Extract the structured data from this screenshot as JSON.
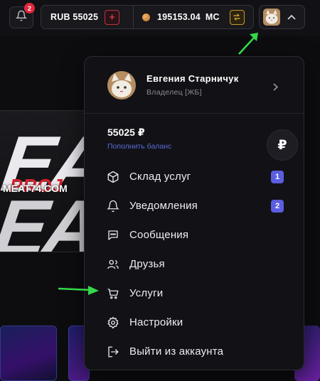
{
  "topbar": {
    "notification_count": "2",
    "rub_balance": "RUB 55025",
    "rub_add": "+",
    "mc_balance": "195153.04",
    "mc_unit": "MC",
    "exchange_icon": "exchange-icon"
  },
  "banner": {
    "url": "MEAT74.COM",
    "big_text": "EA",
    "proj_text": "PROJ"
  },
  "profile": {
    "name": "Евгения Старничук",
    "role": "Владелец [ЖБ]"
  },
  "balance": {
    "amount": "55025 ₽",
    "topup_link": "Пополнить баланс",
    "currency_symbol": "₽"
  },
  "menu": {
    "items": [
      {
        "label": "Склад услуг",
        "icon": "box-icon",
        "badge": "1"
      },
      {
        "label": "Уведомления",
        "icon": "bell-icon",
        "badge": "2"
      },
      {
        "label": "Сообщения",
        "icon": "chat-icon"
      },
      {
        "label": "Друзья",
        "icon": "friends-icon"
      },
      {
        "label": "Услуги",
        "icon": "cart-icon"
      },
      {
        "label": "Настройки",
        "icon": "gear-icon"
      },
      {
        "label": "Выйти из аккаунта",
        "icon": "logout-icon"
      }
    ]
  },
  "colors": {
    "accent": "#5a5ee0",
    "danger": "#e3283c",
    "gold": "#e6b53a",
    "arrow": "#35d84a"
  }
}
